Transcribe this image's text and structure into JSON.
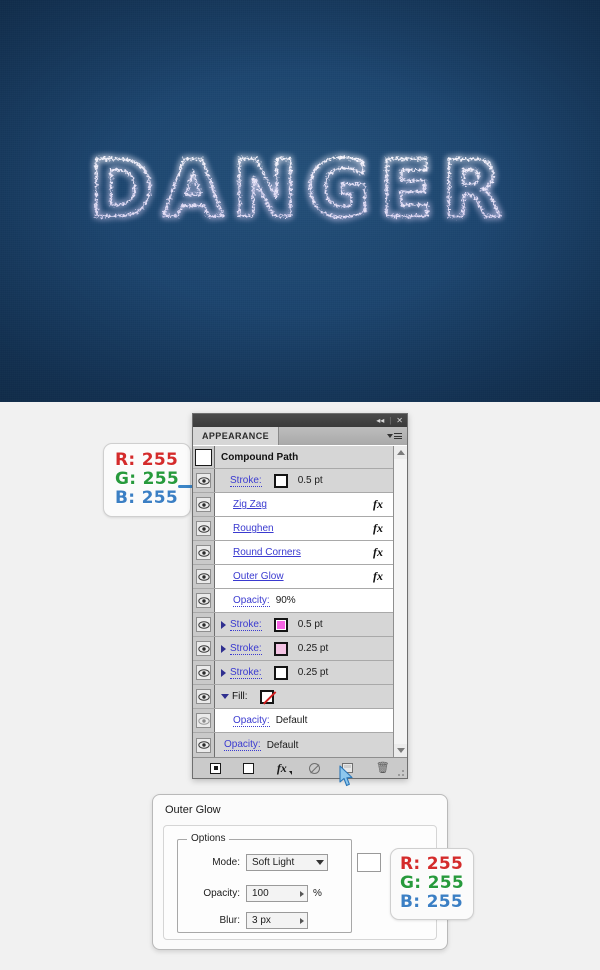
{
  "artwork": {
    "word": "DANGER",
    "background_color": "#1d4670",
    "glow_color": "#e8e6ff"
  },
  "callouts": {
    "stroke_rgb": {
      "r": "R: 255",
      "g": "G: 255",
      "b": "B: 255"
    },
    "glow_rgb": {
      "r": "R: 255",
      "g": "G: 255",
      "b": "B: 255"
    }
  },
  "appearance_panel": {
    "tab_label": "APPEARANCE",
    "collapse_icon": "◂◂",
    "close_icon": "✕",
    "rows": [
      {
        "kind": "header",
        "thumb": true,
        "label": "Compound Path"
      },
      {
        "kind": "stroke",
        "label": "Stroke:",
        "swatch": "#ffffff",
        "value": "0.5 pt",
        "disclosure": "none"
      },
      {
        "kind": "effect",
        "label": "Zig Zag",
        "fx": "fx"
      },
      {
        "kind": "effect",
        "label": "Roughen",
        "fx": "fx"
      },
      {
        "kind": "effect",
        "label": "Round Corners",
        "fx": "fx"
      },
      {
        "kind": "effect",
        "label": "Outer Glow",
        "fx": "fx"
      },
      {
        "kind": "opacity",
        "label": "Opacity:",
        "value": "90%"
      },
      {
        "kind": "stroke",
        "label": "Stroke:",
        "swatch": "#f563e3",
        "value": "0.5 pt",
        "disclosure": "right"
      },
      {
        "kind": "stroke",
        "label": "Stroke:",
        "swatch": "#f4c4e4",
        "value": "0.25 pt",
        "disclosure": "right"
      },
      {
        "kind": "stroke",
        "label": "Stroke:",
        "swatch": "#ffffff",
        "value": "0.25 pt",
        "disclosure": "right"
      },
      {
        "kind": "fill",
        "label": "Fill:",
        "swatch": "none",
        "value": "",
        "disclosure": "down"
      },
      {
        "kind": "opacity",
        "label": "Opacity:",
        "value": "Default"
      },
      {
        "kind": "opacity",
        "label": "Opacity:",
        "value": "Default"
      }
    ],
    "footer": {
      "add_new_stroke": "add-new-stroke",
      "add_new_fill": "add-new-fill",
      "add_new_effect": "fx",
      "clear_appearance": "clear-appearance",
      "duplicate_item": "duplicate-selected-item",
      "delete_item": "delete-selected-item"
    }
  },
  "outer_glow_dialog": {
    "title": "Outer Glow",
    "options_legend": "Options",
    "mode_label": "Mode:",
    "mode_value": "Soft Light",
    "mode_color": "#ffffff",
    "opacity_label": "Opacity:",
    "opacity_value": "100",
    "opacity_unit": "%",
    "blur_label": "Blur:",
    "blur_value": "3 px"
  }
}
